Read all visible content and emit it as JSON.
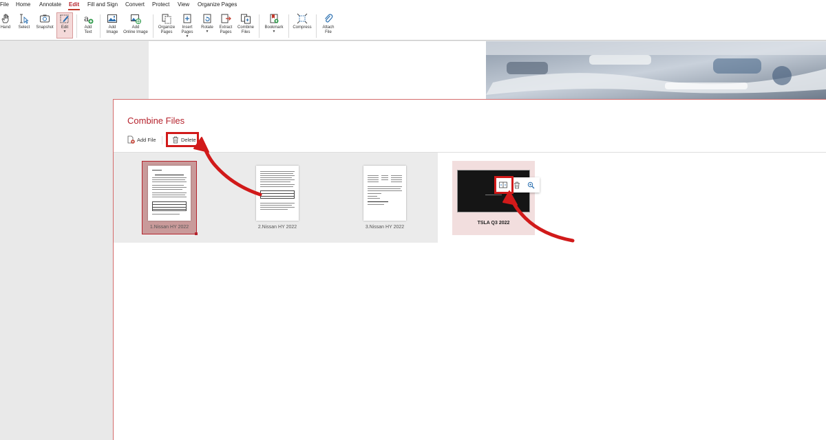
{
  "menu": {
    "items": [
      "File",
      "Home",
      "Annotate",
      "Edit",
      "Fill and Sign",
      "Convert",
      "Protect",
      "View",
      "Organize Pages"
    ],
    "active": "Edit"
  },
  "toolbar": {
    "hand": "Hand",
    "select": "Select",
    "snapshot": "Snapshot",
    "edit": "Edit",
    "add_text": "Add\nText",
    "add_image": "Add\nImage",
    "add_online_image": "Add\nOnline Image",
    "organize_pages": "Organize\nPages",
    "insert_pages": "Insert\nPages",
    "rotate": "Rotate",
    "extract_pages": "Extract\nPages",
    "combine_files": "Combine\nFiles",
    "bookmark": "Bookmark",
    "compress": "Compress",
    "attach_file": "Attach\nFile"
  },
  "dialog": {
    "title": "Combine Files",
    "add_file": "Add File",
    "delete": "Delete"
  },
  "files": [
    {
      "label": "1.Nissan HY 2022",
      "selected": true
    },
    {
      "label": "2.Nissan HY 2022",
      "selected": false
    },
    {
      "label": "3.Nissan HY 2022",
      "selected": false
    },
    {
      "label": "TSLA Q3 2022",
      "selected": false,
      "hovered": true
    }
  ],
  "colors": {
    "accent": "#b5222c",
    "highlight": "#d11a1a",
    "selected_bg": "#c99a9a",
    "hover_bg": "#f2dede"
  }
}
